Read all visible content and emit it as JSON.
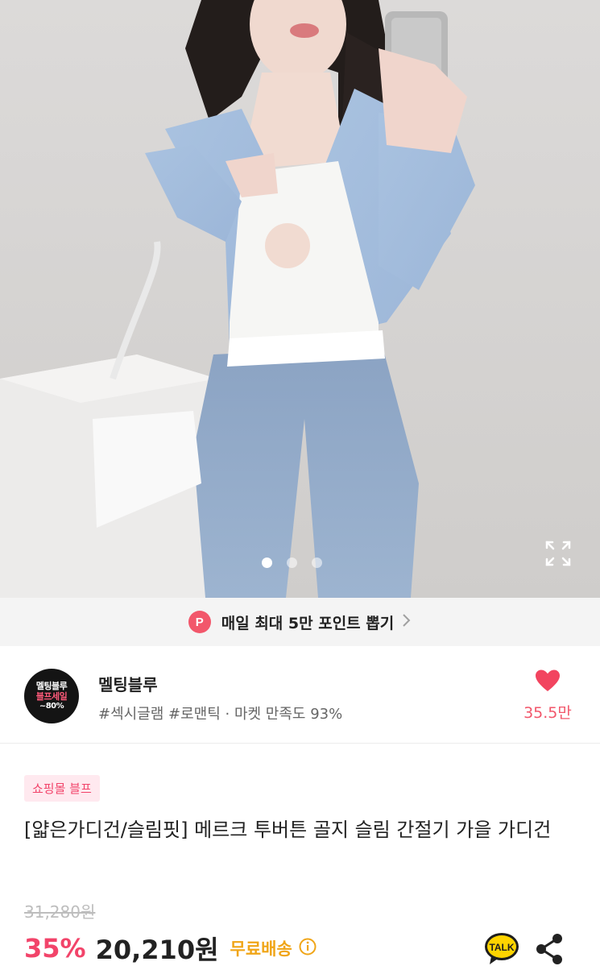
{
  "gallery": {
    "dot_count": 3,
    "active_index": 0
  },
  "point_banner": {
    "badge": "P",
    "text": "매일 최대 5만 포인트 뽑기",
    "chevron": "chevron-right-icon"
  },
  "seller": {
    "avatar_lines": [
      "멜팅블루",
      "블프세일",
      "~80%"
    ],
    "name": "멜팅블루",
    "tags": "#섹시글램 #로맨틱 · 마켓 만족도 93%",
    "like_count": "35.5만",
    "like_icon": "heart-icon"
  },
  "product": {
    "badge": "쇼핑몰 블프",
    "title": "[얇은가디건/슬림핏] 메르크 투버튼 골지 슬림 간절기 가을 가디건",
    "original_price": "31,280원",
    "discount": "35%",
    "price": "20,210원",
    "shipping": "무료배송"
  },
  "colors": {
    "accent": "#f2446a",
    "shipping": "#f0a517",
    "point_badge": "#f2576b"
  }
}
